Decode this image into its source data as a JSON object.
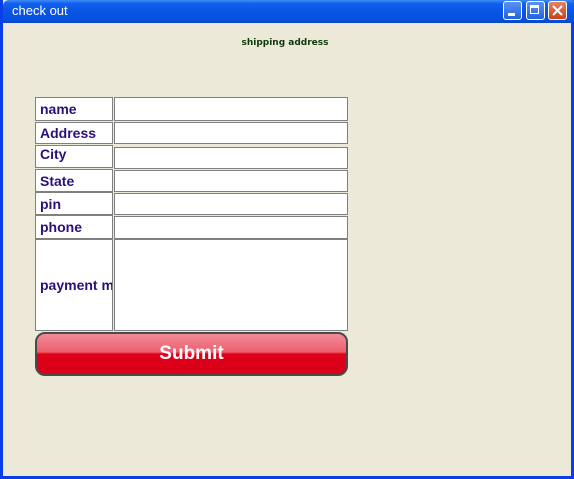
{
  "window": {
    "title": "check out"
  },
  "form": {
    "heading": "shipping address",
    "fields": {
      "name": {
        "label": "name",
        "value": ""
      },
      "address": {
        "label": "Address",
        "value": ""
      },
      "city": {
        "label": "City",
        "value": ""
      },
      "state": {
        "label": "State",
        "value": ""
      },
      "pin": {
        "label": "pin",
        "value": ""
      },
      "phone": {
        "label": "phone",
        "value": ""
      },
      "payment": {
        "label": "payment m",
        "value": ""
      }
    },
    "submit_label": "Submit"
  },
  "colors": {
    "titlebar": "#0a55e4",
    "window_bg": "#ece9d8",
    "label_text": "#2b0f7a",
    "submit_red": "#e0001a"
  },
  "icons": {
    "minimize": "minimize-icon",
    "maximize": "maximize-icon",
    "close": "close-icon"
  }
}
